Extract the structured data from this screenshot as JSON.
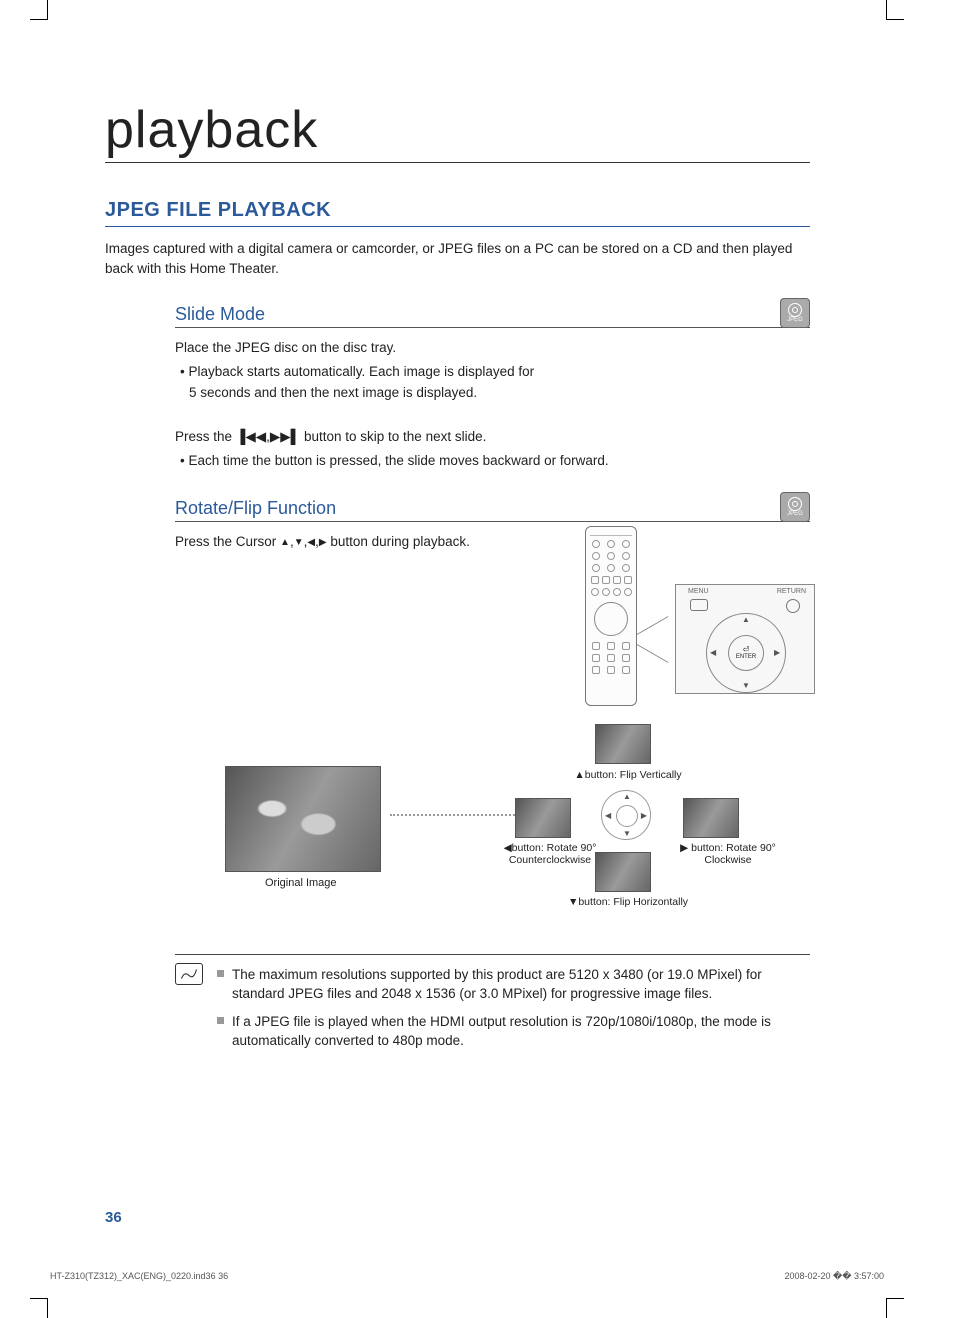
{
  "chapter": "playback",
  "section": "JPEG FILE PLAYBACK",
  "intro": "Images captured with a digital camera or camcorder, or JPEG files on a PC can be stored on a CD and then played back with this Home Theater.",
  "slide": {
    "title": "Slide Mode",
    "p1": "Place the JPEG disc on the disc tray.",
    "b1": "• Playback starts automatically. Each image is displayed for 5 seconds and then the next image is displayed.",
    "p2a": "Press the ",
    "p2b": " button to skip to the next slide.",
    "b2": "• Each time the button is pressed, the slide moves backward or forward."
  },
  "rotate": {
    "title": "Rotate/Flip Function",
    "p1a": "Press the Cursor ",
    "p1b": " button during playback."
  },
  "panel": {
    "menu": "MENU",
    "return": "RETURN",
    "enter": "ENTER"
  },
  "diagram": {
    "orig": "Original Image",
    "up": "button: Flip Vertically",
    "down": "button: Flip Horizontally",
    "left1": "button: Rotate 90°",
    "left2": "Counterclockwise",
    "right1": "button: Rotate 90°",
    "right2": "Clockwise"
  },
  "notes": {
    "n1": "The maximum resolutions supported by this product are 5120 x 3480 (or 19.0 MPixel) for standard JPEG files and 2048 x 1536 (or 3.0 MPixel) for progressive image files.",
    "n2": "If a JPEG file is played when the HDMI output resolution is 720p/1080i/1080p, the mode is automatically converted to 480p mode."
  },
  "jpeg_badge": "JPEG",
  "page_number": "36",
  "footer_left": "HT-Z310(TZ312)_XAC(ENG)_0220.ind36   36",
  "footer_right": "2008-02-20   �� 3:57:00"
}
